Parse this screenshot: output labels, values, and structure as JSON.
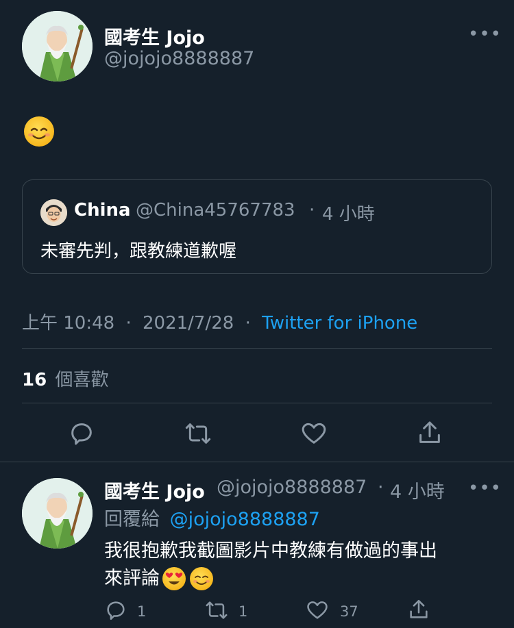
{
  "main_tweet": {
    "display_name": "國考生 Jojo",
    "handle": "@jojojo8888887",
    "more_label": "•••",
    "body_emoji": "relieved-face-emoji",
    "quoted": {
      "display_name": "China",
      "handle": "@China45767783",
      "separator": "·",
      "time_ago": "4 小時",
      "text": "未審先判，跟教練道歉喔"
    },
    "time": "上午 10:48",
    "dot1": "·",
    "date": "2021/7/28",
    "dot2": "·",
    "source": "Twitter for iPhone",
    "likes_count": "16",
    "likes_label": "個喜歡"
  },
  "reply_tweet": {
    "display_name": "國考生 Jojo",
    "handle": "@jojojo8888887",
    "separator": "·",
    "time_ago": "4 小時",
    "more_label": "•••",
    "replying_label": "回覆給",
    "replying_to": "@jojojo8888887",
    "text_line1": "我很抱歉我截圖影片中教練有做過的事出",
    "text_line2": "來評論",
    "reply_count": "1",
    "retweet_count": "1",
    "like_count": "37"
  },
  "colors": {
    "background": "#15202b",
    "secondary_text": "#8b98a5",
    "link": "#1da1f2",
    "border": "#38444d"
  }
}
